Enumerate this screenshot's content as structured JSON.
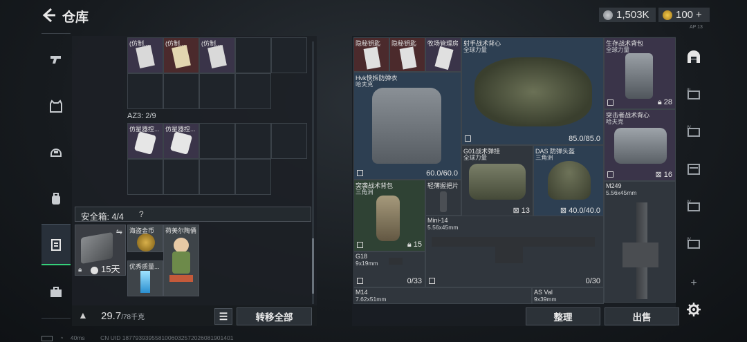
{
  "header": {
    "title": "仓库",
    "currency1": "1,503K",
    "currency2": "100",
    "currency2_plus": "+",
    "corner_code": "AP 13"
  },
  "left_rail": {
    "items": [
      {
        "icon": "pistol-icon"
      },
      {
        "icon": "vest-icon"
      },
      {
        "icon": "helmet-icon"
      },
      {
        "icon": "backpack-icon"
      },
      {
        "icon": "container-icon",
        "active": true
      },
      {
        "icon": "briefcase-icon"
      }
    ]
  },
  "left_panel": {
    "top_items": [
      {
        "label": "(仿制..."
      },
      {
        "label": "(仿制..."
      },
      {
        "label": "(仿制..."
      }
    ],
    "az3_label": "AZ3: 2/9",
    "az3_items": [
      {
        "label": "仿星器控..."
      },
      {
        "label": "仿星器控..."
      }
    ],
    "safe_label": "安全箱: 4/4",
    "safe_help": "?",
    "safe_box": {
      "days": "15天"
    },
    "safe_items": [
      {
        "label": "海盗金币"
      },
      {
        "label": "荷美尔陶俑"
      },
      {
        "label": "优秀质量..."
      }
    ],
    "weight_value": "29.7",
    "weight_unit": "/78千克",
    "transfer_all": "转移全部"
  },
  "right_panel": {
    "items": [
      {
        "label": "隐秘钥匙"
      },
      {
        "label": "隐秘钥匙"
      },
      {
        "label": "牧场管理房"
      },
      {
        "label": "射手战术背心",
        "sub": "全球力量"
      },
      {
        "label": "生存战术背包",
        "sub": "全球力量",
        "count": "28"
      },
      {
        "label": "Hvk快拆防弹衣",
        "sub": "哈夫克",
        "durability": "60.0/60.0"
      },
      {
        "label": "",
        "durability": "85.0/85.0"
      },
      {
        "label": "突击者战术背心",
        "sub": "哈夫克",
        "count": "16"
      },
      {
        "label": "G01战术弹挂",
        "sub": "全球力量",
        "count": "13"
      },
      {
        "label": "DAS 防弹头盔",
        "sub": "三角洲",
        "durability": "40.0/40.0"
      },
      {
        "label": "突袭战术背包",
        "sub": "三角洲",
        "count": "15"
      },
      {
        "label": "轻薄握把片"
      },
      {
        "label": "M249",
        "sub": "5.56x45mm"
      },
      {
        "label": "Mini-14",
        "sub": "5.56x45mm",
        "ammo": "0/30"
      },
      {
        "label": "G18",
        "sub": "9x19mm",
        "ammo": "0/33"
      },
      {
        "label": "M14",
        "sub": "7.62x51mm"
      },
      {
        "label": "AS Val",
        "sub": "9x39mm"
      }
    ],
    "sort_button": "整理",
    "sell_button": "出售"
  },
  "right_rail": {
    "items": [
      {
        "icon": "home-storage-icon"
      },
      {
        "icon": "storage-tab-3-icon",
        "label": "III"
      },
      {
        "icon": "storage-tab-4-icon",
        "label": "IV"
      },
      {
        "icon": "storage-tab-5-icon"
      },
      {
        "icon": "storage-tab-6-icon",
        "label": "IV"
      },
      {
        "icon": "storage-tab-7-icon",
        "label": "IV"
      },
      {
        "icon": "add-icon",
        "label": "+"
      },
      {
        "icon": "gear-icon"
      }
    ]
  },
  "status_bar": {
    "ping": "40ms",
    "uid": "CN UID 1877939395581006032572026081901401"
  }
}
